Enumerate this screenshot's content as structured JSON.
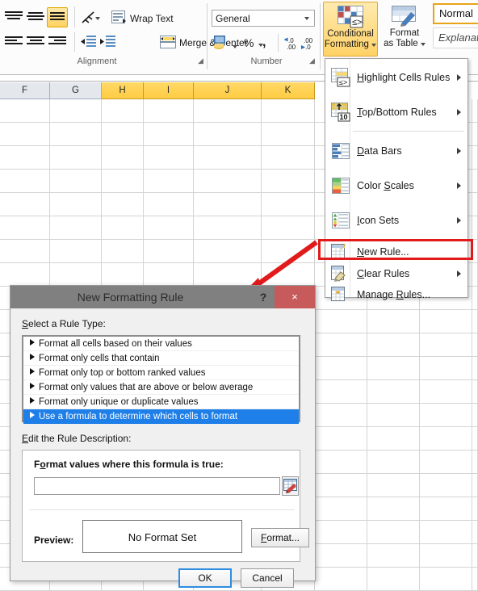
{
  "ribbon": {
    "groups": [
      {
        "name": "Alignment",
        "label": "Alignment"
      },
      {
        "name": "Number",
        "label": "Number"
      }
    ],
    "alignment": {
      "wrap_text_label": "Wrap Text",
      "merge_center_label": "Merge & Center",
      "orientation_icon": "text-orientation-icon",
      "align_top_icon": "align-top-icon",
      "align_middle_icon": "align-middle-icon",
      "align_bottom_icon": "align-bottom-icon",
      "align_left_icon": "align-left-icon",
      "align_center_icon": "align-center-icon",
      "align_right_icon": "align-right-icon",
      "decrease_indent_icon": "decrease-indent-icon",
      "increase_indent_icon": "increase-indent-icon",
      "dialog_launcher_glyph": "◢"
    },
    "number": {
      "format_value": "General",
      "accounting_icon": "accounting-number-format-icon",
      "percent_label": "%",
      "comma_label": ",",
      "increase_decimal_label": ".00",
      "decrease_decimal_label": ".00",
      "dialog_launcher_glyph": "◢"
    },
    "styles": {
      "conditional_formatting_line1": "Conditional",
      "conditional_formatting_line2": "Formatting",
      "format_as_table_line1": "Format",
      "format_as_table_line2": "as Table",
      "cell_style_normal": "Normal",
      "cell_style_explanatory": "Explanatory"
    }
  },
  "cf_menu": {
    "items": [
      {
        "label": "Highlight Cells Rules",
        "underline": "H",
        "icon": "highlight-cells-rules-icon",
        "submenu": true
      },
      {
        "label": "Top/Bottom Rules",
        "underline": "T",
        "icon": "top-bottom-rules-icon",
        "submenu": true
      },
      {
        "label": "Data Bars",
        "underline": "D",
        "icon": "data-bars-icon",
        "submenu": true
      },
      {
        "label": "Color Scales",
        "underline": "S",
        "icon": "color-scales-icon",
        "submenu": true
      },
      {
        "label": "Icon Sets",
        "underline": "I",
        "icon": "icon-sets-icon",
        "submenu": true
      },
      {
        "label": "New Rule...",
        "underline": "N",
        "icon": "new-rule-icon",
        "submenu": false
      },
      {
        "label": "Clear Rules",
        "underline": "C",
        "icon": "clear-rules-icon",
        "submenu": true
      },
      {
        "label": "Manage Rules...",
        "underline": "R",
        "icon": "manage-rules-icon",
        "submenu": false
      }
    ],
    "highlight_color": "#e11b1b",
    "highlighted_item": "New Rule..."
  },
  "sheet": {
    "column_headers": [
      "F",
      "G",
      "H",
      "I",
      "J",
      "K"
    ],
    "highlighted_columns": [
      "H",
      "I",
      "J",
      "K"
    ],
    "highlight_color": "#ffd054"
  },
  "annotation": {
    "arrow_color": "#e11b1b",
    "type": "arrow-annotation",
    "from": "New Rule... menu item",
    "to": "New Formatting Rule dialog title bar"
  },
  "dialog": {
    "title": "New Formatting Rule",
    "help_glyph": "?",
    "close_glyph": "×",
    "select_rule_type_label": "Select a Rule Type:",
    "rule_types": [
      {
        "label": "Format all cells based on their values",
        "selected": false
      },
      {
        "label": "Format only cells that contain",
        "selected": false
      },
      {
        "label": "Format only top or bottom ranked values",
        "selected": false
      },
      {
        "label": "Format only values that are above or below average",
        "selected": false
      },
      {
        "label": "Format only unique or duplicate values",
        "selected": false
      },
      {
        "label": "Use a formula to determine which cells to format",
        "selected": true
      }
    ],
    "edit_rule_description_label": "Edit the Rule Description:",
    "formula_prompt": "Format values where this formula is true:",
    "formula_value": "",
    "range_picker_icon": "range-selector-icon",
    "preview_label": "Preview:",
    "preview_text": "No Format Set",
    "format_button_label": "Format...",
    "ok_button_label": "OK",
    "cancel_button_label": "Cancel",
    "selection_color": "#1f7fe8"
  }
}
